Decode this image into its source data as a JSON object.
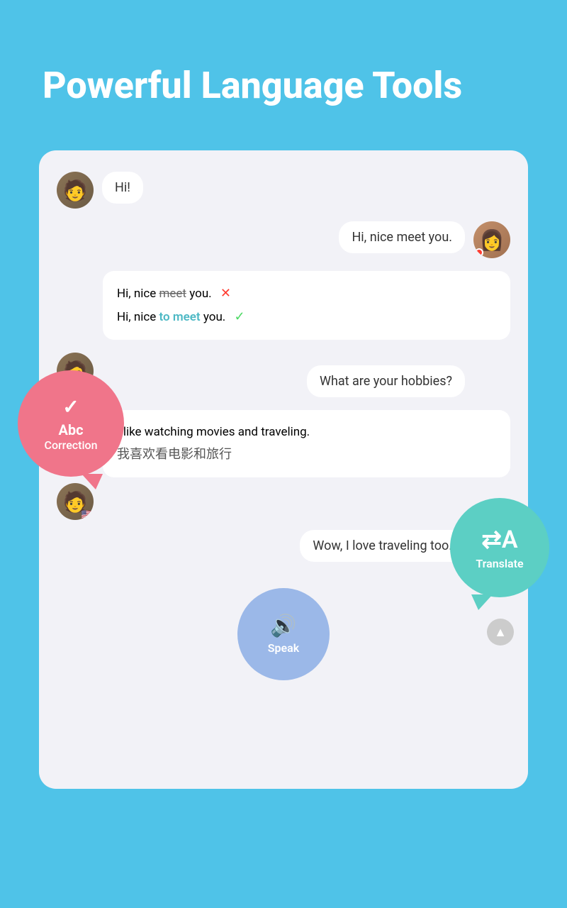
{
  "page": {
    "title": "Powerful Language Tools",
    "background": "#4fc3e8"
  },
  "chat": {
    "messages": [
      {
        "id": "msg1",
        "side": "left",
        "text": "Hi!",
        "avatar": "male"
      },
      {
        "id": "msg2",
        "side": "right",
        "text": "Hi, nice meet you.",
        "avatar": "female"
      },
      {
        "id": "msg3",
        "side": "left",
        "text": "What are your hobbies?",
        "avatar": null
      },
      {
        "id": "msg4",
        "side": "left",
        "text": "I like watching movies and traveling.",
        "avatar": "male"
      },
      {
        "id": "msg5",
        "side": "right",
        "text": "Wow, I love traveling too.",
        "avatar": "female"
      }
    ],
    "correction": {
      "wrong_line": "Hi, nice meet you.",
      "correct_line": "Hi, nice to meet you.",
      "wrong_word": "meet",
      "correct_words": "to meet"
    },
    "translation": {
      "original": "I like watching movies and traveling.",
      "translated": "我喜欢看电影和旅行"
    }
  },
  "tools": {
    "abc_correction": {
      "check_symbol": "✓",
      "title": "Abc",
      "subtitle": "Correction"
    },
    "translate": {
      "label": "Translate"
    },
    "speak": {
      "label": "Speak"
    }
  }
}
